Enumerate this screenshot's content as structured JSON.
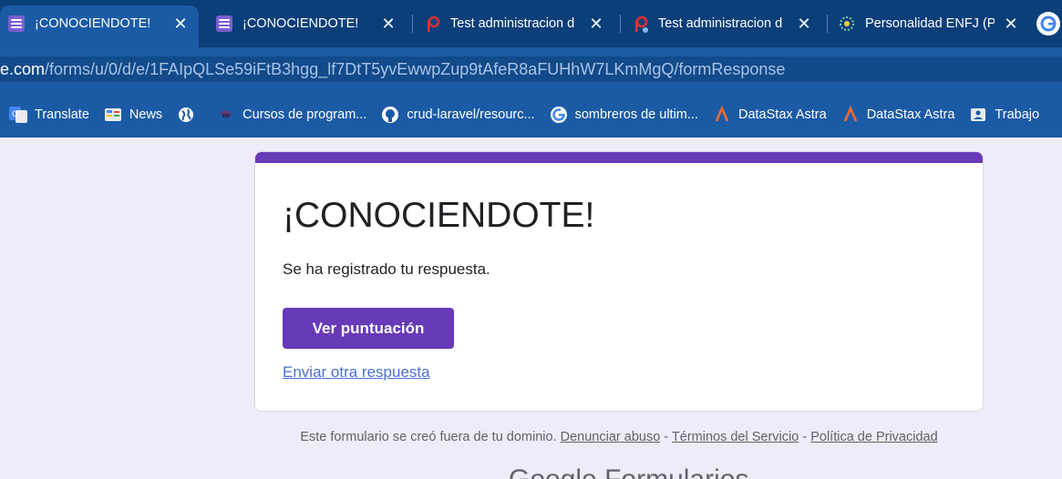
{
  "tabs": [
    {
      "title": "¡CONOCIENDOTE!",
      "favicon": "google-forms-icon",
      "active": true
    },
    {
      "title": "¡CONOCIENDOTE!",
      "favicon": "google-forms-icon",
      "active": false
    },
    {
      "title": "Test administracion d",
      "favicon": "test-site-icon",
      "active": false
    },
    {
      "title": "Test administracion d",
      "favicon": "test-site-icon",
      "active": false
    },
    {
      "title": "Personalidad ENFJ (P",
      "favicon": "personality-site-icon",
      "active": false
    }
  ],
  "close_glyph": "✕",
  "address": {
    "domain_part": "e.com",
    "path_part": "/forms/u/0/d/e/1FAIpQLSe59iFtB3hgg_lf7DtT5yvEwwpZup9tAfeR8aFUHhW7LKmMgQ/formResponse"
  },
  "bookmarks": [
    {
      "label": "Translate",
      "icon": "google-translate-icon"
    },
    {
      "label": "News",
      "icon": "google-news-icon"
    },
    {
      "label": "",
      "icon": "globe-icon"
    },
    {
      "label": "Cursos de program...",
      "icon": "graduation-cap-icon"
    },
    {
      "label": "crud-laravel/resourc...",
      "icon": "github-icon"
    },
    {
      "label": "sombreros de ultim...",
      "icon": "google-icon"
    },
    {
      "label": "DataStax Astra",
      "icon": "datastax-icon"
    },
    {
      "label": "DataStax Astra",
      "icon": "datastax-icon"
    },
    {
      "label": "Trabajo",
      "icon": "contact-icon"
    }
  ],
  "form": {
    "title": "¡CONOCIENDOTE!",
    "confirmation": "Se ha registrado tu respuesta.",
    "score_button": "Ver puntuación",
    "another_link": "Enviar otra respuesta",
    "accent_color": "#673ab7"
  },
  "footer": {
    "text": "Este formulario se creó fuera de tu dominio.",
    "abuse_link": "Denunciar abuso",
    "sep": " - ",
    "terms_link": "Términos del Servicio",
    "privacy_link": "Política de Privacidad"
  },
  "brand": "Google Formularios"
}
